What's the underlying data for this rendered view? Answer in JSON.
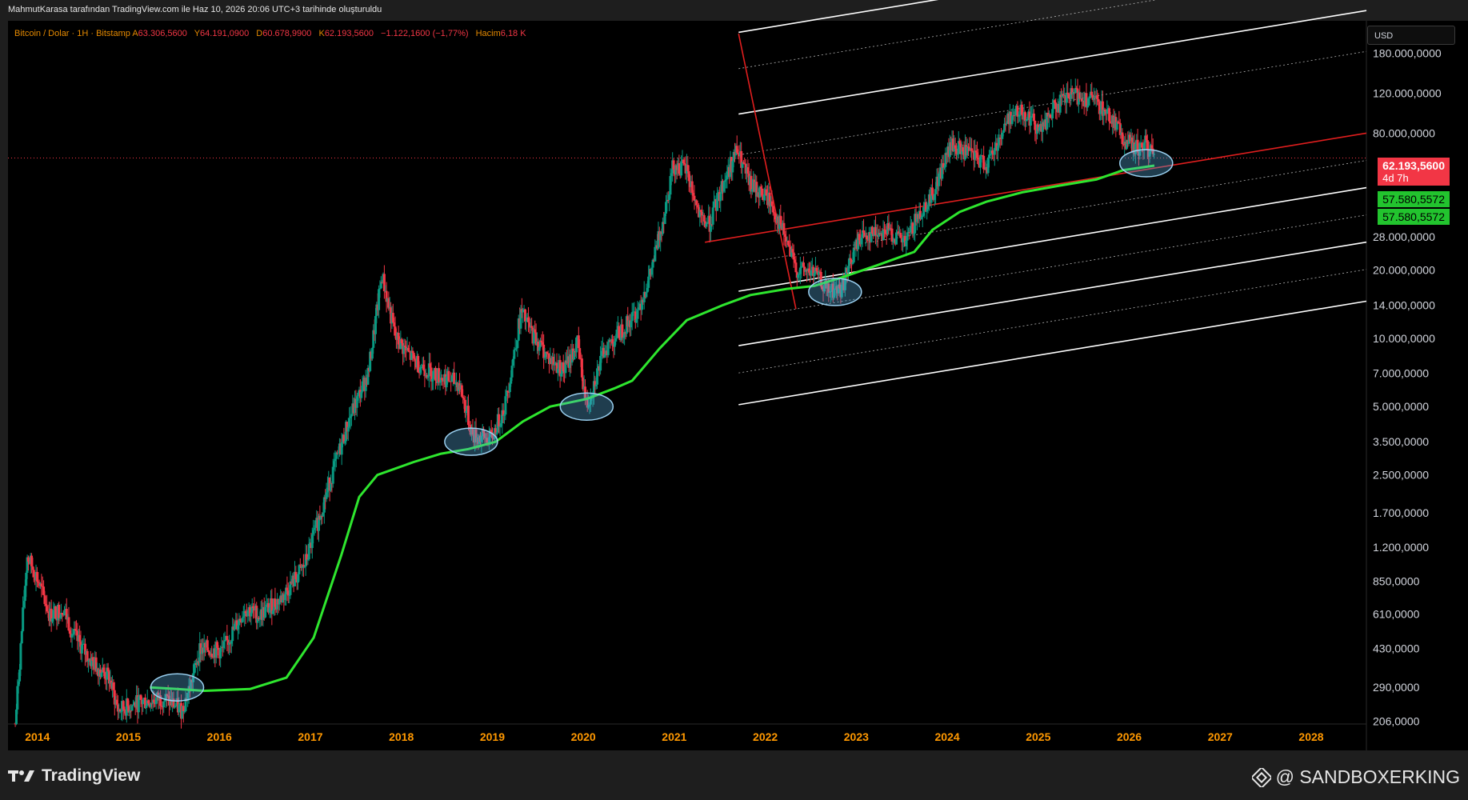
{
  "header": {
    "attribution": "MahmutKarasa tarafından TradingView.com ile Haz 10, 2026 20:06 UTC+3 tarihinde oluşturuldu"
  },
  "legend": {
    "symbol": "Bitcoin / Dolar · 1H · Bitstamp",
    "open_label": "A",
    "open": "63.306,5600",
    "high_label": "Y",
    "high": "64.191,0900",
    "low_label": "D",
    "low": "60.678,9900",
    "close_label": "K",
    "close": "62.193,5600",
    "change": "−1.122,1600 (−1,77%)",
    "volume_label": "Hacim",
    "volume": "6,18 K"
  },
  "currency": "USD",
  "price_tags": {
    "last_price": "62.193,5600",
    "countdown": "4d 7h",
    "ma_value_1": "57.580,5572",
    "ma_value_2": "57.580,5572"
  },
  "colors": {
    "background": "#000000",
    "up": "#089981",
    "down": "#f23645",
    "ma": "#2ee62e",
    "regression_mid": "#e01e1e",
    "channel": "#ffffff",
    "axis_text": "#d1d4dc",
    "year_text": "#ff9800",
    "highlight": "#5aaee0"
  },
  "footer": {
    "brand": "TradingView",
    "brand_icon": "tradingview-logo-icon",
    "author": "@ SANDBOXERKING",
    "author_icon": "binance-logo-icon"
  },
  "chart_data": {
    "type": "candlestick",
    "title": "",
    "scale": "log",
    "y_axis_side": "right",
    "x_ticks": [
      "2014",
      "2015",
      "2016",
      "2017",
      "2018",
      "2019",
      "2020",
      "2021",
      "2022",
      "2023",
      "2024",
      "2025",
      "2026",
      "2027",
      "2028"
    ],
    "y_ticks": [
      {
        "value": 180000,
        "label": "180.000,0000"
      },
      {
        "value": 120000,
        "label": "120.000,0000"
      },
      {
        "value": 80000,
        "label": "80.000,0000"
      },
      {
        "value": 28000,
        "label": "28.000,0000"
      },
      {
        "value": 20000,
        "label": "20.000,0000"
      },
      {
        "value": 14000,
        "label": "14.000,0000"
      },
      {
        "value": 10000,
        "label": "10.000,0000"
      },
      {
        "value": 7000,
        "label": "7.000,0000"
      },
      {
        "value": 5000,
        "label": "5.000,0000"
      },
      {
        "value": 3500,
        "label": "3.500,0000"
      },
      {
        "value": 2500,
        "label": "2.500,0000"
      },
      {
        "value": 1700,
        "label": "1.700,0000"
      },
      {
        "value": 1200,
        "label": "1.200,0000"
      },
      {
        "value": 850,
        "label": "850,0000"
      },
      {
        "value": 610,
        "label": "610,0000"
      },
      {
        "value": 430,
        "label": "430,0000"
      },
      {
        "value": 290,
        "label": "290,0000"
      },
      {
        "value": 206,
        "label": "206,0000"
      }
    ],
    "x_range": [
      2013.84,
      2028.77
    ],
    "y_range": [
      200,
      250000
    ],
    "last_price": 62193.56,
    "ma_last": 57580.5572,
    "price_path": [
      [
        2013.92,
        200
      ],
      [
        2014.05,
        1100
      ],
      [
        2014.15,
        900
      ],
      [
        2014.3,
        600
      ],
      [
        2014.45,
        650
      ],
      [
        2014.55,
        500
      ],
      [
        2014.75,
        380
      ],
      [
        2014.95,
        320
      ],
      [
        2015.05,
        230
      ],
      [
        2015.3,
        250
      ],
      [
        2015.55,
        260
      ],
      [
        2015.75,
        230
      ],
      [
        2015.85,
        300
      ],
      [
        2015.95,
        430
      ],
      [
        2016.2,
        420
      ],
      [
        2016.45,
        650
      ],
      [
        2016.6,
        600
      ],
      [
        2016.85,
        720
      ],
      [
        2017.1,
        1000
      ],
      [
        2017.4,
        2500
      ],
      [
        2017.6,
        4500
      ],
      [
        2017.8,
        7000
      ],
      [
        2017.95,
        19000
      ],
      [
        2018.1,
        10000
      ],
      [
        2018.3,
        8000
      ],
      [
        2018.5,
        7000
      ],
      [
        2018.8,
        6300
      ],
      [
        2018.95,
        3700
      ],
      [
        2019.15,
        3600
      ],
      [
        2019.3,
        5000
      ],
      [
        2019.48,
        13000
      ],
      [
        2019.6,
        10500
      ],
      [
        2019.8,
        8000
      ],
      [
        2019.95,
        7200
      ],
      [
        2020.1,
        9500
      ],
      [
        2020.2,
        5000
      ],
      [
        2020.4,
        9000
      ],
      [
        2020.6,
        11000
      ],
      [
        2020.75,
        13000
      ],
      [
        2020.9,
        19000
      ],
      [
        2021.05,
        35000
      ],
      [
        2021.15,
        58000
      ],
      [
        2021.3,
        55000
      ],
      [
        2021.45,
        33000
      ],
      [
        2021.55,
        32000
      ],
      [
        2021.7,
        48000
      ],
      [
        2021.85,
        67000
      ],
      [
        2022.0,
        47000
      ],
      [
        2022.2,
        41000
      ],
      [
        2022.35,
        30000
      ],
      [
        2022.5,
        20000
      ],
      [
        2022.7,
        19500
      ],
      [
        2022.85,
        16000
      ],
      [
        2023.0,
        16500
      ],
      [
        2023.2,
        28000
      ],
      [
        2023.5,
        30000
      ],
      [
        2023.7,
        26000
      ],
      [
        2023.85,
        35000
      ],
      [
        2024.0,
        43000
      ],
      [
        2024.2,
        70000
      ],
      [
        2024.4,
        65000
      ],
      [
        2024.6,
        58000
      ],
      [
        2024.85,
        95000
      ],
      [
        2025.0,
        100000
      ],
      [
        2025.2,
        82000
      ],
      [
        2025.35,
        105000
      ],
      [
        2025.55,
        118000
      ],
      [
        2025.75,
        112000
      ],
      [
        2025.85,
        105000
      ],
      [
        2026.0,
        90000
      ],
      [
        2026.1,
        75000
      ],
      [
        2026.25,
        68000
      ],
      [
        2026.35,
        72000
      ],
      [
        2026.44,
        62193.56
      ]
    ],
    "ma_path": [
      [
        2015.4,
        290
      ],
      [
        2015.7,
        285
      ],
      [
        2016.0,
        280
      ],
      [
        2016.5,
        285
      ],
      [
        2016.9,
        320
      ],
      [
        2017.2,
        480
      ],
      [
        2017.5,
        1100
      ],
      [
        2017.7,
        2000
      ],
      [
        2017.9,
        2500
      ],
      [
        2018.3,
        2850
      ],
      [
        2018.6,
        3100
      ],
      [
        2018.9,
        3250
      ],
      [
        2019.2,
        3500
      ],
      [
        2019.5,
        4300
      ],
      [
        2019.8,
        5000
      ],
      [
        2020.2,
        5400
      ],
      [
        2020.5,
        6000
      ],
      [
        2020.7,
        6500
      ],
      [
        2021.0,
        9000
      ],
      [
        2021.3,
        12000
      ],
      [
        2021.7,
        14000
      ],
      [
        2022.0,
        15500
      ],
      [
        2022.4,
        16500
      ],
      [
        2022.7,
        17000
      ],
      [
        2023.0,
        18500
      ],
      [
        2023.4,
        21000
      ],
      [
        2023.8,
        24000
      ],
      [
        2024.0,
        30000
      ],
      [
        2024.3,
        36000
      ],
      [
        2024.6,
        40000
      ],
      [
        2025.0,
        44000
      ],
      [
        2025.4,
        47000
      ],
      [
        2025.8,
        50000
      ],
      [
        2026.1,
        55000
      ],
      [
        2026.44,
        57580.56
      ]
    ],
    "regression_channel": {
      "start_x": 2021.87,
      "end_x": 2028.77,
      "mid_start": 28000,
      "mid_end": 80000,
      "mid_extend_start_x": 2021.5,
      "upper_offsets": [
        0.36,
        0.54,
        0.74,
        0.9,
        1.08,
        1.3
      ],
      "lower_offsets": [
        -0.12,
        -0.24,
        -0.36,
        -0.48,
        -0.6,
        -0.74
      ],
      "solid_offsets": [
        1.3,
        0.9,
        0.54,
        -0.24,
        -0.48,
        -0.74
      ]
    },
    "highlights": [
      {
        "x": 2015.7,
        "y": 290
      },
      {
        "x": 2018.93,
        "y": 3500
      },
      {
        "x": 2020.2,
        "y": 5000
      },
      {
        "x": 2022.93,
        "y": 16000
      },
      {
        "x": 2026.35,
        "y": 59000
      }
    ]
  }
}
